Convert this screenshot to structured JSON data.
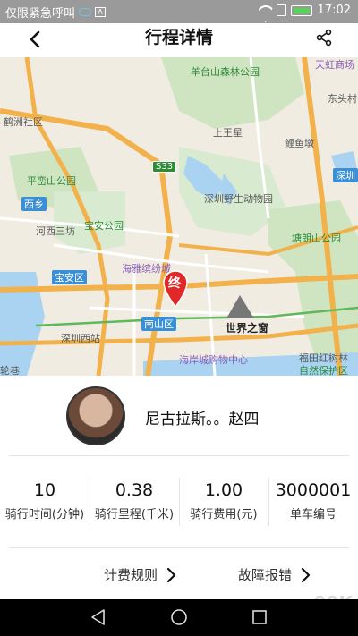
{
  "status_bar": {
    "left_text": "仅限紧急呼叫",
    "time": "17:02"
  },
  "header": {
    "title": "行程详情"
  },
  "map": {
    "labels": {
      "yangtai": "羊台山森林公园",
      "tianhong": "天虹商场",
      "dongxie": "东头村",
      "hexie": "鹤洲社区",
      "shangwu": "上王星",
      "liyu": "鲤鱼墩",
      "s33": "S33",
      "shenzhen_r": "深圳",
      "pingluan": "平峦山公园",
      "zoo": "深圳野生动物园",
      "xixiang": "西乡",
      "hexisan": "河西三坊",
      "baoan_park": "宝安公园",
      "tanglang": "塘朗山公园",
      "baoan_district": "宝安区",
      "haiya": "海雅缤纷城",
      "nanshan_district": "南山区",
      "window": "世界之窗",
      "shenzhen_west": "深圳西站",
      "haian": "海岸城购物中心",
      "futian": "福田红树林",
      "nature": "自然保护区",
      "bottom_left": "轮巷",
      "end_marker": "终"
    }
  },
  "profile": {
    "name": "尼古拉斯。。赵四"
  },
  "stats": [
    {
      "value": "10",
      "label": "骑行时间(分钟)"
    },
    {
      "value": "0.38",
      "label": "骑行里程(千米)"
    },
    {
      "value": "1.00",
      "label": "骑行费用(元)"
    },
    {
      "value": "3000001",
      "label": "单车编号"
    }
  ],
  "links": {
    "fee_rules": "计费规则",
    "fault_report": "故障报错"
  },
  "watermark": "99K"
}
